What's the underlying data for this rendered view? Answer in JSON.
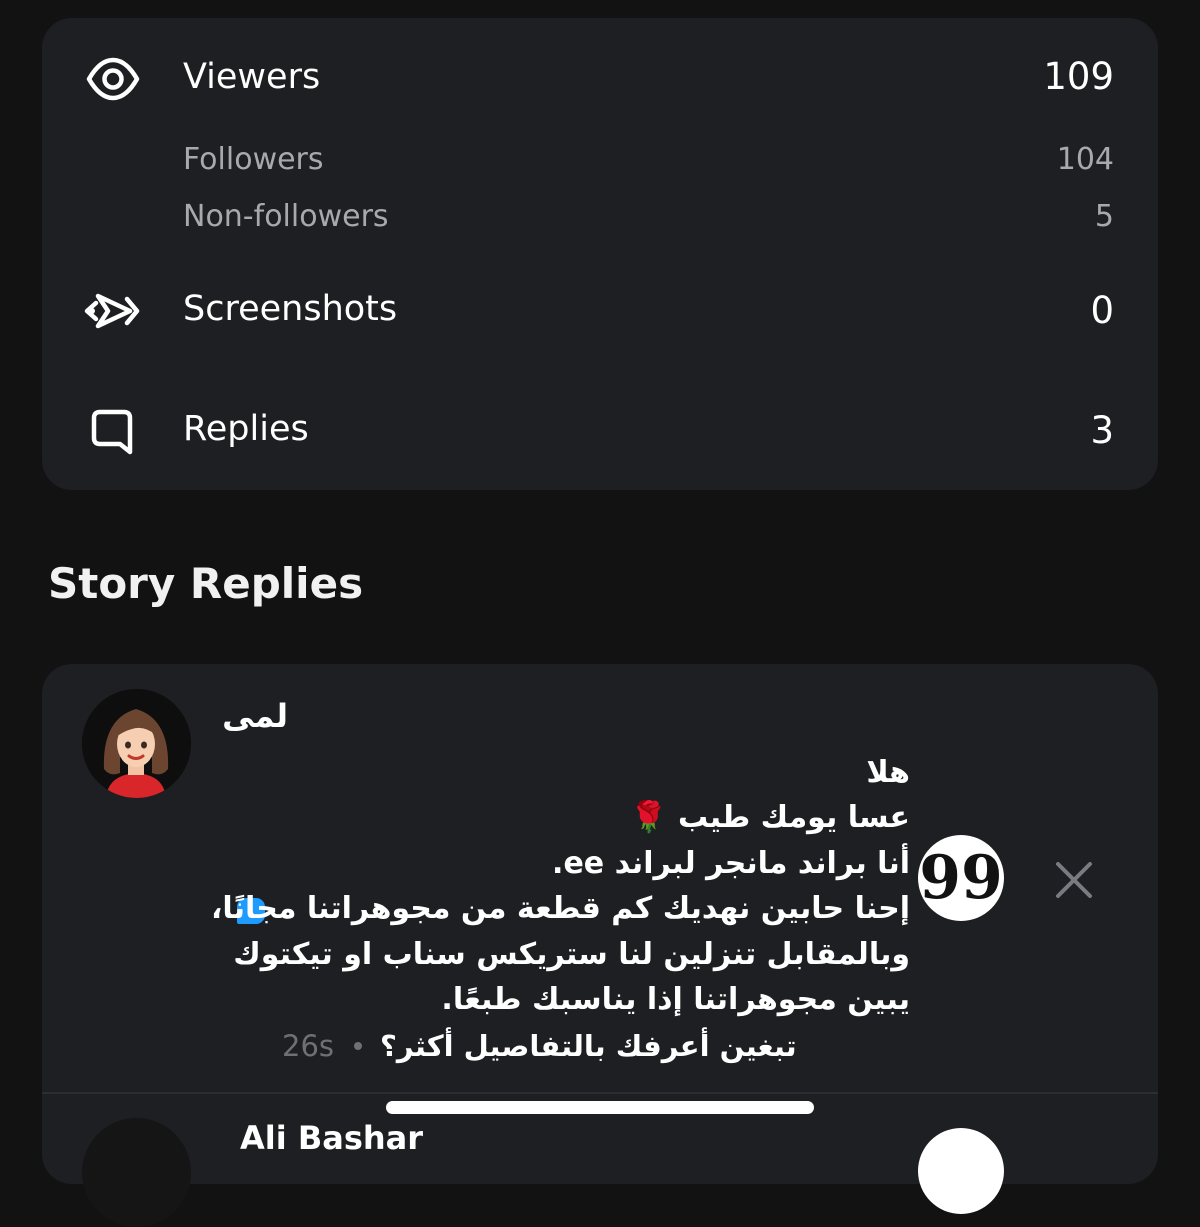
{
  "stats": {
    "viewers": {
      "label": "Viewers",
      "value": "109",
      "icon": "eye-icon"
    },
    "followers": {
      "label": "Followers",
      "value": "104"
    },
    "non_followers": {
      "label": "Non-followers",
      "value": "5"
    },
    "screenshots": {
      "label": "Screenshots",
      "value": "0",
      "icon": "screenshot-arrows-icon"
    },
    "replies": {
      "label": "Replies",
      "value": "3",
      "icon": "chat-bubble-icon"
    }
  },
  "section_title": "Story Replies",
  "reply": {
    "name": "لمى",
    "message_lines": [
      "هلا",
      "عسا يومك طيب 🌹",
      "أنا براند مانجر لبراند ee.",
      "إحنا حابين نهديك كم قطعة من مجوهراتنا مجانًا،",
      "وبالمقابل تنزلين لنا ستريكس سناب او تيكتوك",
      "يبين مجوهراتنا إذا يناسبك طبعًا."
    ],
    "footer_text": "تبغين أعرفك بالتفاصيل أكثر؟",
    "time": "26s",
    "quote_glyph": "99",
    "icons": [
      "avatar",
      "chat-indicator-icon",
      "quote-icon",
      "close-icon"
    ]
  },
  "next_reply": {
    "name": "Ali Bashar"
  },
  "colors": {
    "background": "#121212",
    "card": "#1e1f22",
    "primary_text": "#ffffff",
    "secondary_text": "#a8a8ad",
    "muted_text": "#6f6f74",
    "accent_blue": "#1e9bff"
  }
}
